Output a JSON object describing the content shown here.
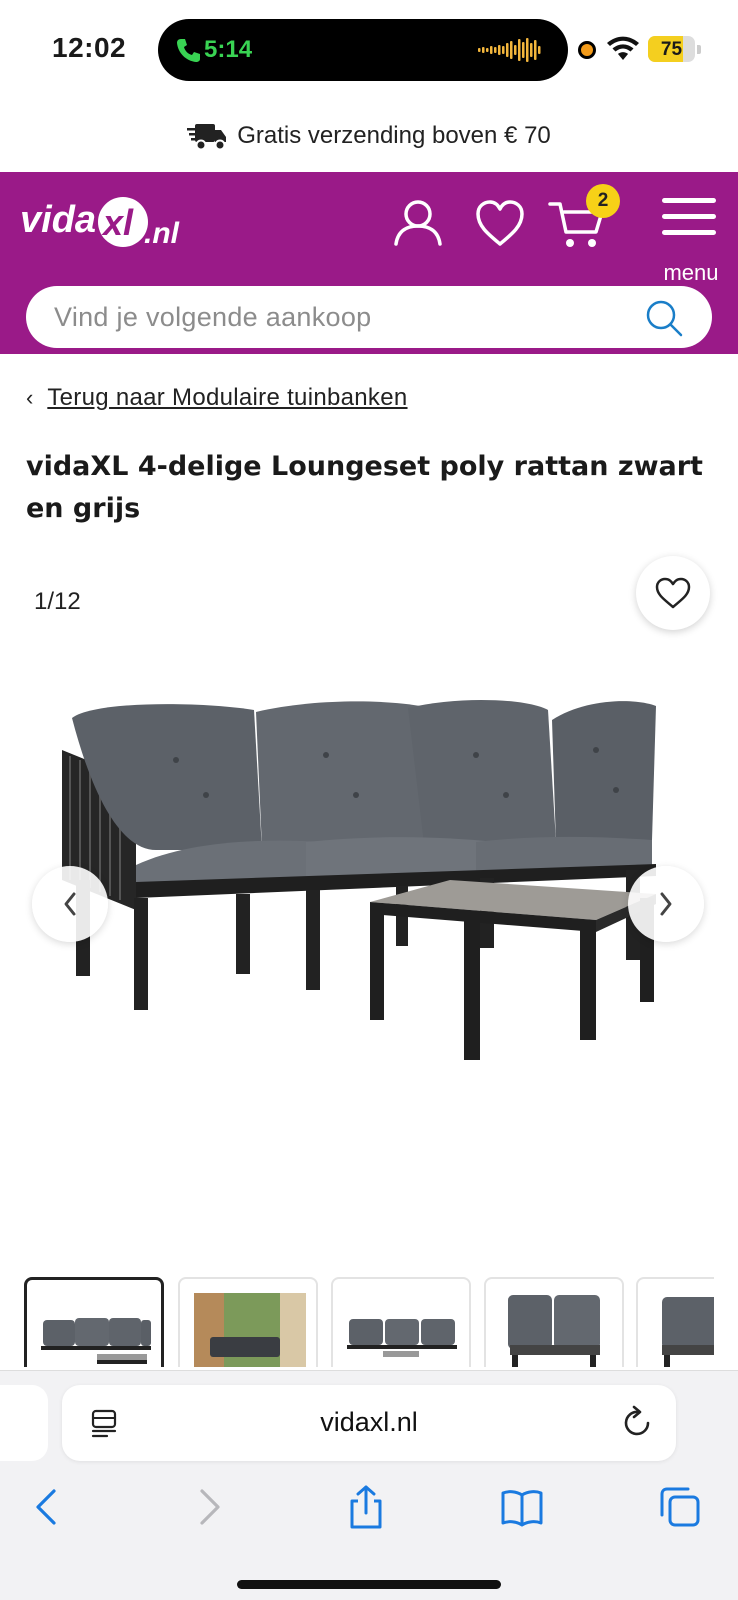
{
  "status_bar": {
    "time": "12:02",
    "call_timer": "5:14",
    "battery": "75",
    "battery_level": 0.75
  },
  "banner": {
    "shipping_text": "Gratis verzending boven € 70"
  },
  "header": {
    "brand_color": "#9a1a88",
    "logo_text": "vidaXL.nl",
    "cart_count": "2",
    "menu_label": "menu",
    "search_placeholder": "Vind je volgende aankoop",
    "icons": [
      "account-icon",
      "wishlist-icon",
      "cart-icon",
      "menu-icon",
      "search-icon"
    ]
  },
  "breadcrumb": {
    "back_label": "Terug naar Modulaire tuinbanken"
  },
  "product": {
    "title": "vidaXL 4-delige Loungeset poly rattan zwart en grijs",
    "image_counter": "1/12",
    "thumbnails": [
      "thumb-1",
      "thumb-2",
      "thumb-3",
      "thumb-4",
      "thumb-5"
    ]
  },
  "browser": {
    "url": "vidaxl.nl",
    "toolbar": [
      "back-icon",
      "forward-icon",
      "share-icon",
      "bookmarks-icon",
      "tabs-icon"
    ]
  }
}
